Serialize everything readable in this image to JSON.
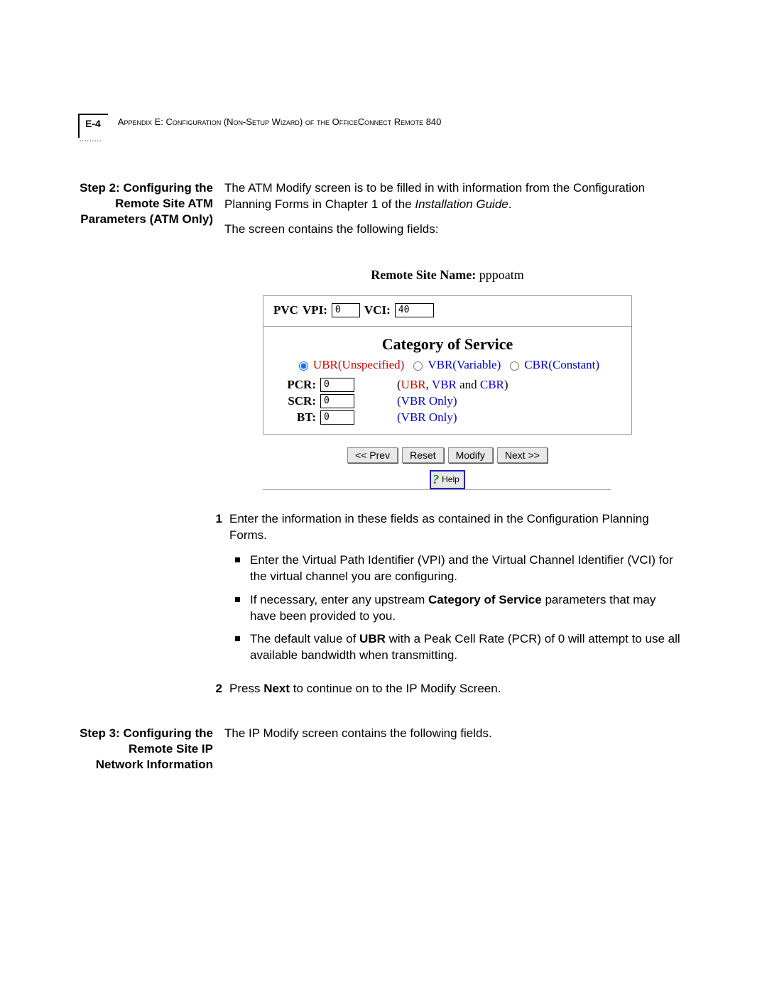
{
  "header": {
    "page_number": "E-4",
    "text": "Appendix E: Configuration (Non-Setup Wizard) of the OfficeConnect Remote 840"
  },
  "step2": {
    "side_heading": "Step 2: Configuring the Remote Site ATM Parameters (ATM Only)",
    "para1": "The ATM Modify screen is to be filled in with information from the Configuration Planning Forms in Chapter 1 of the ",
    "para1_em": "Installation Guide",
    "para1_end": ".",
    "para2": "The screen contains the following fields:"
  },
  "figure": {
    "remote_label": "Remote Site Name:",
    "remote_value": "pppoatm",
    "pvc_label": "PVC",
    "vpi_label": "VPI:",
    "vpi_value": "0",
    "vci_label": "VCI:",
    "vci_value": "40",
    "cos_title": "Category of Service",
    "radio_ubr": "UBR(Unspecified)",
    "radio_vbr": "VBR(Variable)",
    "radio_cbr": "CBR(Constant)",
    "pcr_label": "PCR:",
    "pcr_value": "0",
    "pcr_note_open": "(",
    "pcr_note_ubr": "UBR",
    "pcr_note_sep1": ", ",
    "pcr_note_vbr": "VBR",
    "pcr_note_mid": " and ",
    "pcr_note_cbr": "CBR",
    "pcr_note_close": ")",
    "scr_label": "SCR:",
    "scr_value": "0",
    "scr_note": "(VBR Only)",
    "bt_label": "BT:",
    "bt_value": "0",
    "bt_note": "(VBR Only)",
    "btn_prev": "<< Prev",
    "btn_reset": "Reset",
    "btn_modify": "Modify",
    "btn_next": "Next >>",
    "btn_help": "Help"
  },
  "instructions": {
    "n1": "1",
    "i1": "Enter the information in these fields as contained in the Configuration Planning Forms.",
    "b1": "Enter the Virtual Path Identifier (VPI) and the Virtual Channel Identifier (VCI) for the virtual channel you are configuring.",
    "b2_a": "If necessary, enter any upstream ",
    "b2_b": "Category of Service",
    "b2_c": " parameters that may have been provided to you.",
    "b3_a": "The default value of ",
    "b3_b": "UBR",
    "b3_c": " with a Peak Cell Rate (PCR) of 0 will attempt to use all available bandwidth when transmitting.",
    "n2": "2",
    "i2_a": "Press ",
    "i2_b": "Next",
    "i2_c": " to continue on to the IP Modify Screen."
  },
  "step3": {
    "side_heading": "Step 3: Configuring the Remote Site IP Network Information",
    "para1": "The IP Modify screen contains the following fields."
  }
}
